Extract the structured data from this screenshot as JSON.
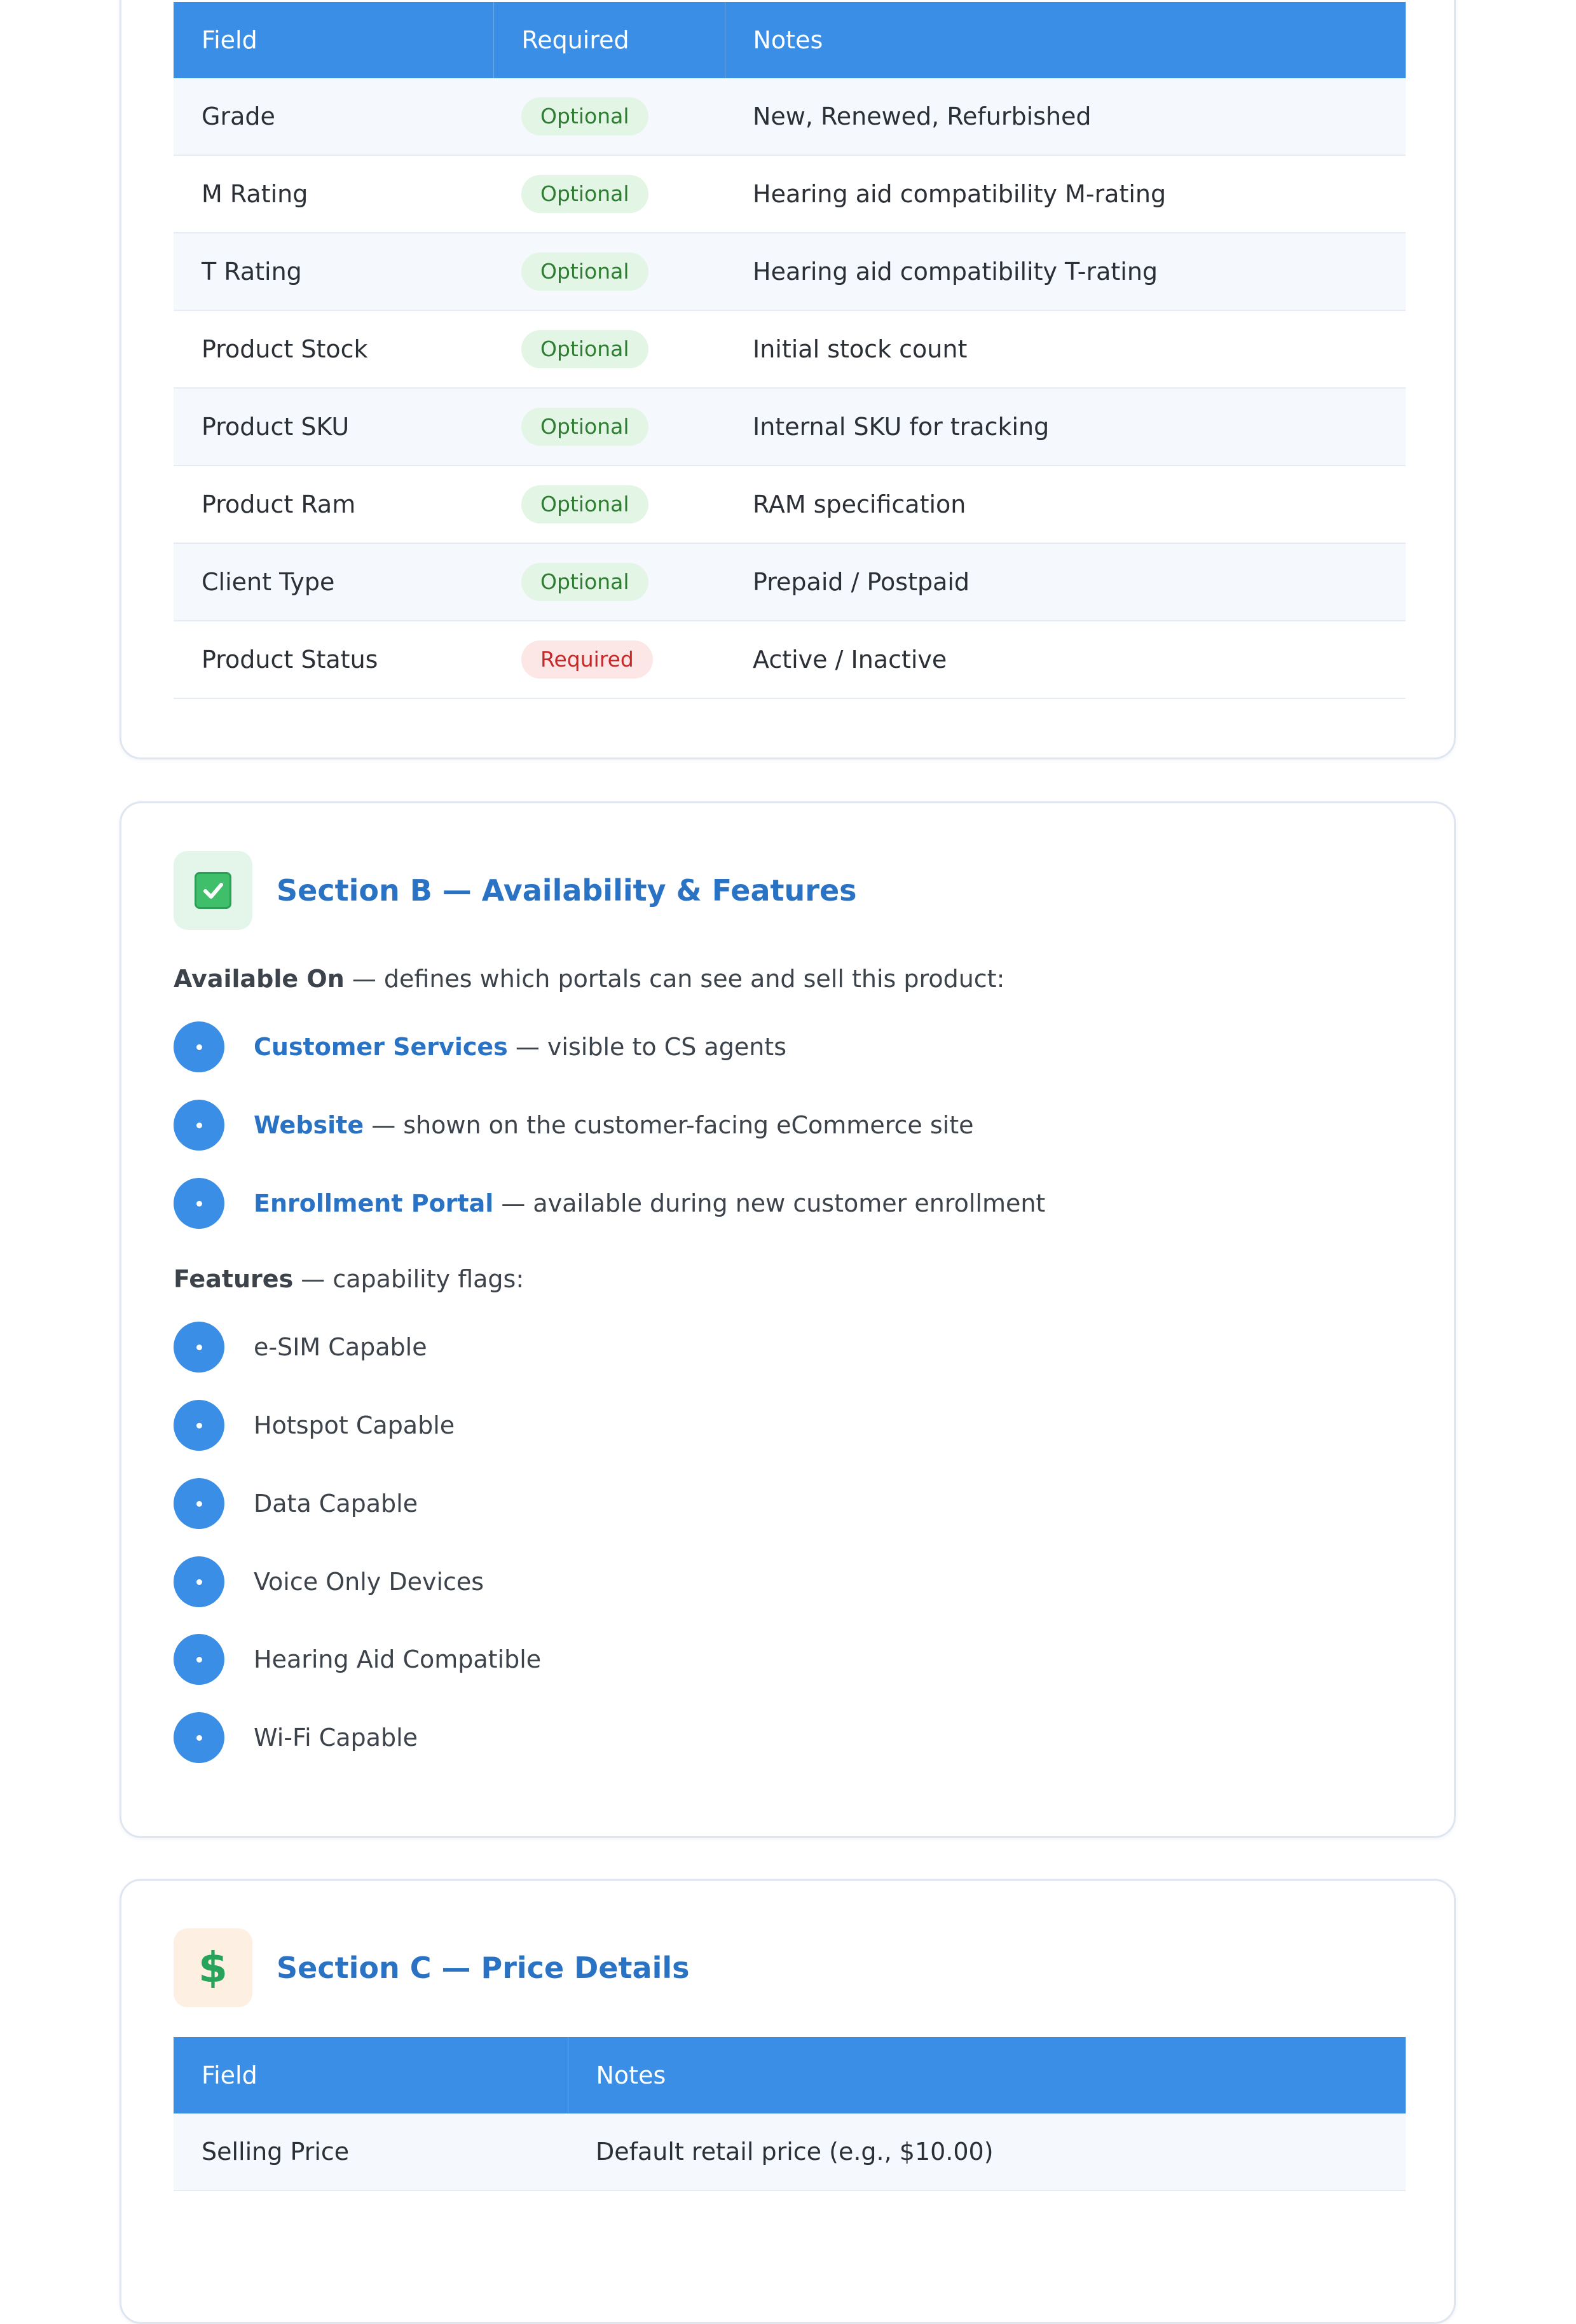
{
  "section_a": {
    "table": {
      "headers": [
        "Field",
        "Required",
        "Notes"
      ],
      "rows": [
        {
          "field": "Grade",
          "required": "Optional",
          "notes": "New, Renewed, Refurbished"
        },
        {
          "field": "M Rating",
          "required": "Optional",
          "notes": "Hearing aid compatibility M-rating"
        },
        {
          "field": "T Rating",
          "required": "Optional",
          "notes": "Hearing aid compatibility T-rating"
        },
        {
          "field": "Product Stock",
          "required": "Optional",
          "notes": "Initial stock count"
        },
        {
          "field": "Product SKU",
          "required": "Optional",
          "notes": "Internal SKU for tracking"
        },
        {
          "field": "Product Ram",
          "required": "Optional",
          "notes": "RAM specification"
        },
        {
          "field": "Client Type",
          "required": "Optional",
          "notes": "Prepaid / Postpaid"
        },
        {
          "field": "Product Status",
          "required": "Required",
          "notes": "Active / Inactive"
        }
      ]
    }
  },
  "section_b": {
    "icon": "checkbox-icon",
    "title": "Section B — Availability & Features",
    "available_intro": {
      "label": "Available On",
      "text": " — defines which portals can see and sell this product:"
    },
    "portals": [
      {
        "name": "Customer Services",
        "desc": " — visible to CS agents"
      },
      {
        "name": "Website",
        "desc": " — shown on the customer-facing eCommerce site"
      },
      {
        "name": "Enrollment Portal",
        "desc": " — available during new customer enrollment"
      }
    ],
    "features_intro": {
      "label": "Features",
      "text": " — capability flags:"
    },
    "features": [
      "e-SIM Capable",
      "Hotspot Capable",
      "Data Capable",
      "Voice Only Devices",
      "Hearing Aid Compatible",
      "Wi-Fi Capable"
    ]
  },
  "section_c": {
    "icon": "dollar-icon",
    "title": "Section C — Price Details",
    "table": {
      "headers": [
        "Field",
        "Notes"
      ],
      "rows": [
        {
          "field": "Selling Price",
          "notes": "Default retail price (e.g., $10.00)"
        }
      ]
    }
  },
  "colors": {
    "accent_blue": "#3a8ee6",
    "title_blue": "#2a73c4",
    "optional_green": "#2e7d32",
    "required_red": "#c62828"
  }
}
